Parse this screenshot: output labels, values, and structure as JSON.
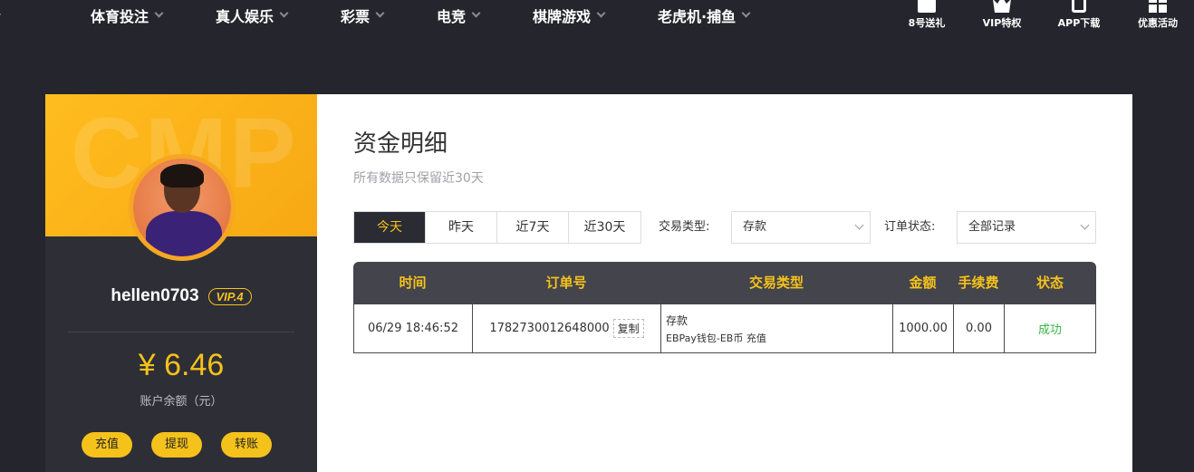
{
  "nav": {
    "items": [
      "体育投注",
      "真人娱乐",
      "彩票",
      "电竞",
      "棋牌游戏",
      "老虎机·捕鱼"
    ],
    "quick": [
      {
        "label": "8号送礼",
        "icon": "gift-icon"
      },
      {
        "label": "VIP特权",
        "icon": "crown-icon"
      },
      {
        "label": "APP下载",
        "icon": "phone-icon"
      },
      {
        "label": "优惠活动",
        "icon": "grid-icon"
      }
    ]
  },
  "profile": {
    "banner_text": "CMP",
    "username": "hellen0703",
    "vip": "VIP.4",
    "balance": "¥ 6.46",
    "balance_label": "账户余额（元）",
    "actions": [
      "充值",
      "提现",
      "转账"
    ]
  },
  "main": {
    "title": "资金明细",
    "subtitle": "所有数据只保留近30天",
    "date_filters": [
      "今天",
      "昨天",
      "近7天",
      "近30天"
    ],
    "active_filter": "今天",
    "type_label": "交易类型:",
    "type_value": "存款",
    "status_label": "订单状态:",
    "status_value": "全部记录",
    "table": {
      "columns": [
        "时间",
        "订单号",
        "交易类型",
        "金额",
        "手续费",
        "状态"
      ],
      "rows": [
        {
          "time": "06/29 18:46:52",
          "order": "1782730012648000",
          "copy": "复制",
          "type": "存款",
          "type_detail": "EBPay钱包-EB币 充值",
          "amount": "1000.00",
          "fee": "0.00",
          "status": "成功"
        }
      ]
    }
  },
  "colors": {
    "accent": "#f5c21b",
    "background": "#25252d",
    "success": "#3ab54a"
  }
}
